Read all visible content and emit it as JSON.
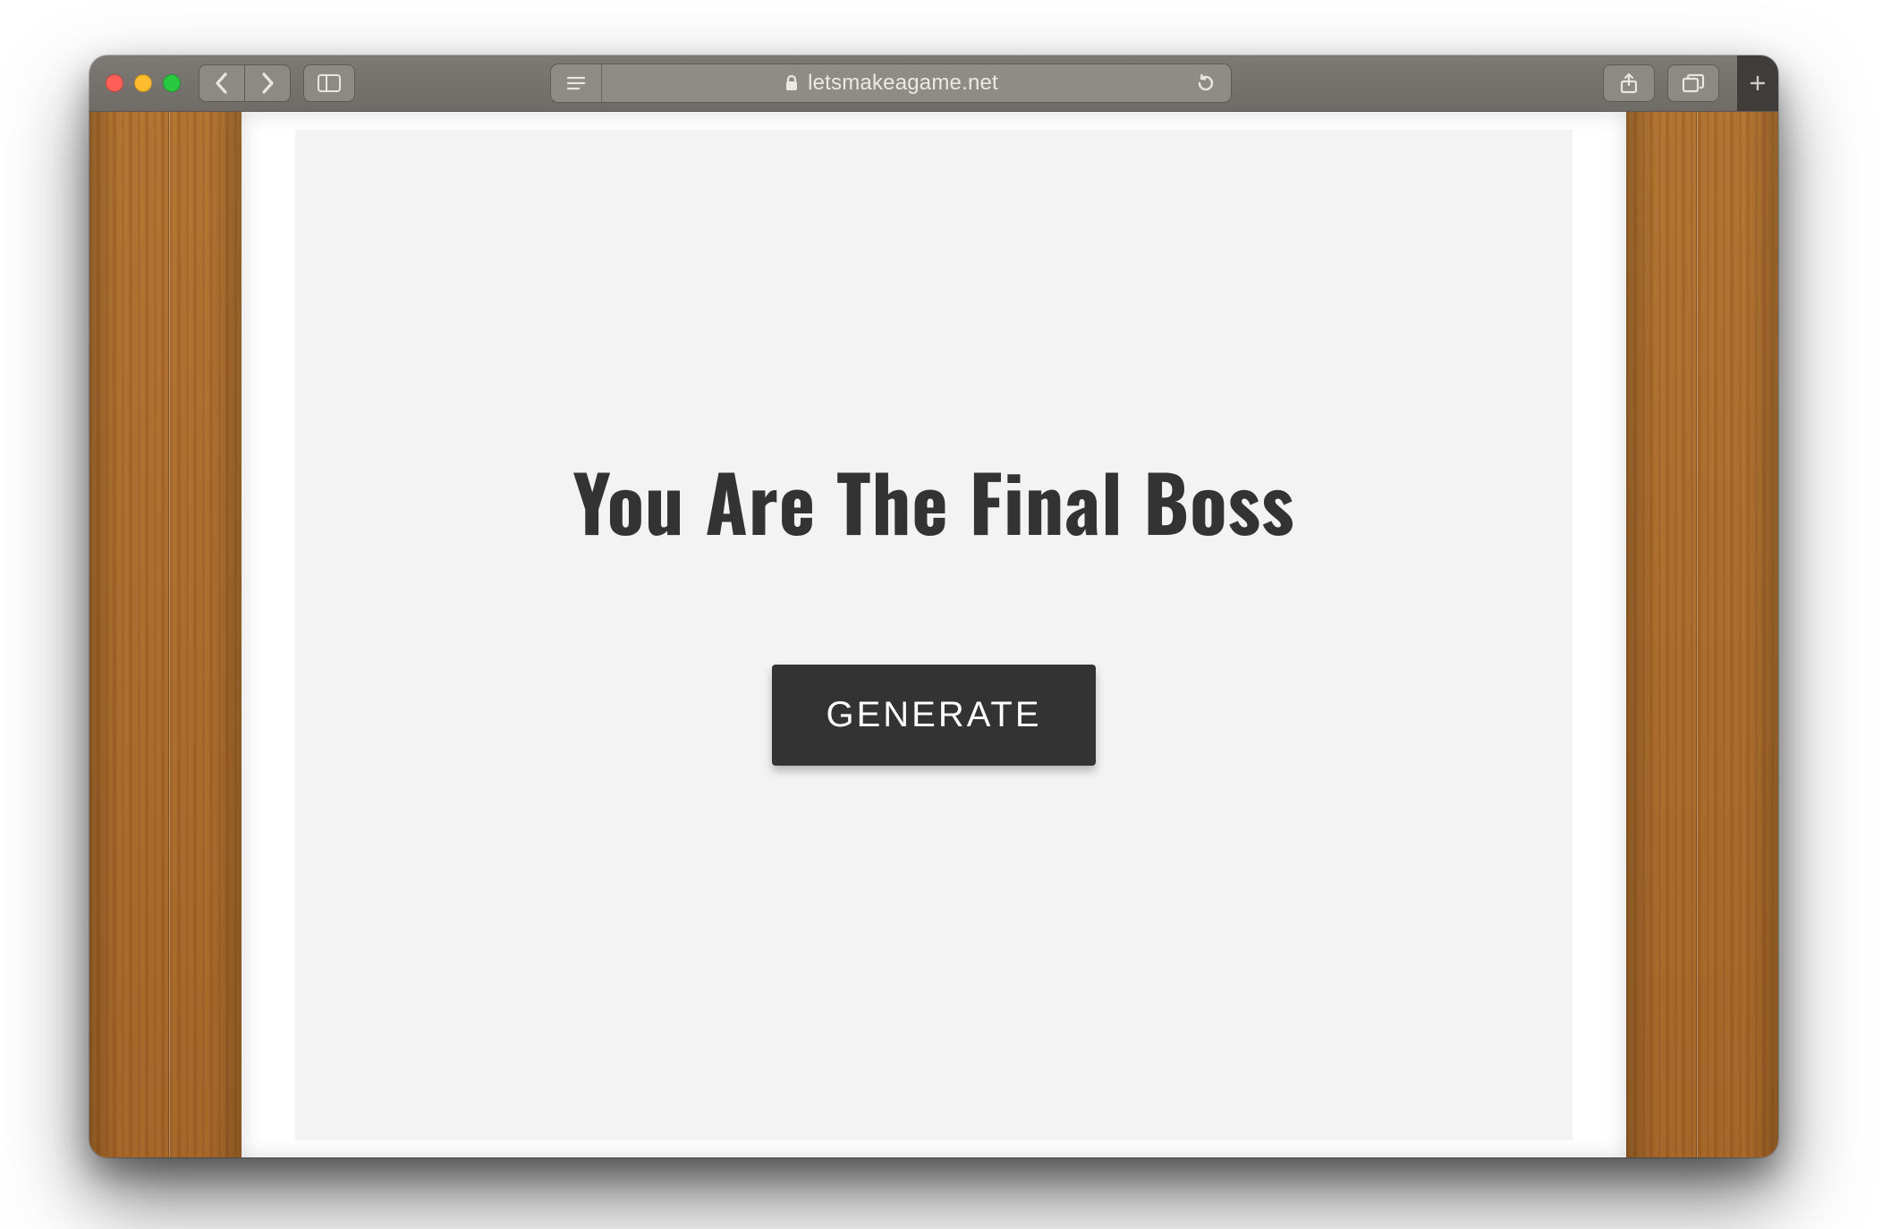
{
  "browser": {
    "url_host": "letsmakeagame.net"
  },
  "page": {
    "headline": "You Are The Final Boss",
    "generate_label": "GENERATE"
  }
}
